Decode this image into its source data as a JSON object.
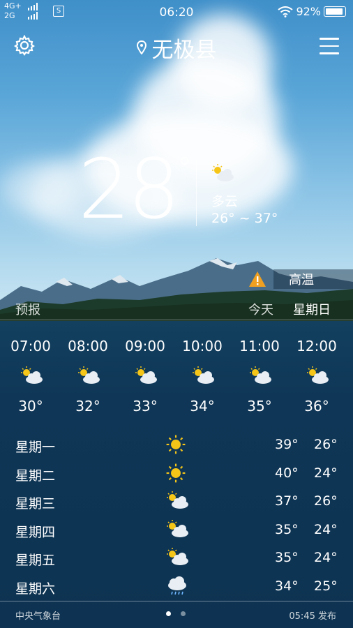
{
  "status": {
    "network_top": "4G+",
    "network_bottom": "2G",
    "sim_badge": "S",
    "time": "06:20",
    "battery": "92%"
  },
  "header": {
    "location": "无极县",
    "icons": [
      "gear-icon",
      "location-pin-icon",
      "menu-icon"
    ]
  },
  "current": {
    "temperature": "28",
    "degree_sign": "°",
    "condition": "多云",
    "range": "26° ~ 37°",
    "icon": "partly-sunny-icon"
  },
  "alert": {
    "label": "高温",
    "icon": "warning-triangle-icon",
    "color": "#f0a020"
  },
  "tabs": {
    "forecast_label": "预报",
    "today": "今天",
    "weekday": "星期日"
  },
  "hourly": [
    {
      "time": "07:00",
      "temp": "30°",
      "icon": "partly-sunny-icon"
    },
    {
      "time": "08:00",
      "temp": "32°",
      "icon": "partly-sunny-icon"
    },
    {
      "time": "09:00",
      "temp": "33°",
      "icon": "partly-sunny-icon"
    },
    {
      "time": "10:00",
      "temp": "34°",
      "icon": "partly-sunny-icon"
    },
    {
      "time": "11:00",
      "temp": "35°",
      "icon": "partly-sunny-icon"
    },
    {
      "time": "12:00",
      "temp": "36°",
      "icon": "partly-sunny-icon"
    }
  ],
  "daily": [
    {
      "day": "星期一",
      "high": "39°",
      "low": "26°",
      "icon": "sun-icon"
    },
    {
      "day": "星期二",
      "high": "40°",
      "low": "24°",
      "icon": "sun-icon"
    },
    {
      "day": "星期三",
      "high": "37°",
      "low": "26°",
      "icon": "partly-sunny-icon"
    },
    {
      "day": "星期四",
      "high": "35°",
      "low": "24°",
      "icon": "partly-sunny-icon"
    },
    {
      "day": "星期五",
      "high": "35°",
      "low": "24°",
      "icon": "partly-sunny-icon"
    },
    {
      "day": "星期六",
      "high": "34°",
      "low": "25°",
      "icon": "rain-cloud-icon"
    }
  ],
  "footer": {
    "source": "中央气象台",
    "published": "05:45 发布",
    "page_count": 2,
    "active_page": 1
  },
  "colors": {
    "sun": "#f5c518",
    "cloud": "#e8eef4",
    "rain": "#6fb6ff",
    "lake": "#0f3554"
  }
}
